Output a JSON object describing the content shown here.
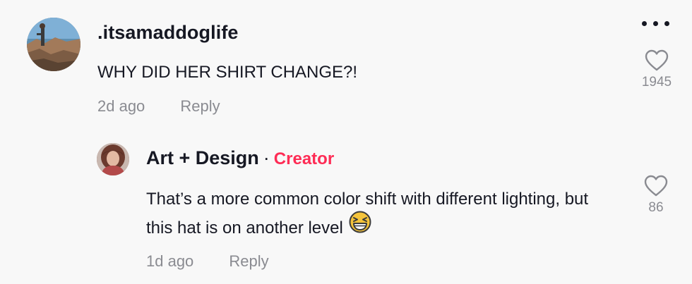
{
  "comment": {
    "username": ".itsamaddoglife",
    "text": "WHY DID HER SHIRT CHANGE?!",
    "time": "2d ago",
    "reply_label": "Reply",
    "likes": "1945"
  },
  "reply": {
    "username": "Art + Design",
    "separator": "·",
    "badge": "Creator",
    "text": "That’s a more common color shift with different lighting, but this hat is on another level",
    "emoji": "grinning-squinting-face",
    "time": "1d ago",
    "reply_label": "Reply",
    "likes": "86"
  },
  "colors": {
    "background": "#f8f8f8",
    "text": "#161823",
    "muted": "#8a8b91",
    "creator": "#fe2c55"
  }
}
